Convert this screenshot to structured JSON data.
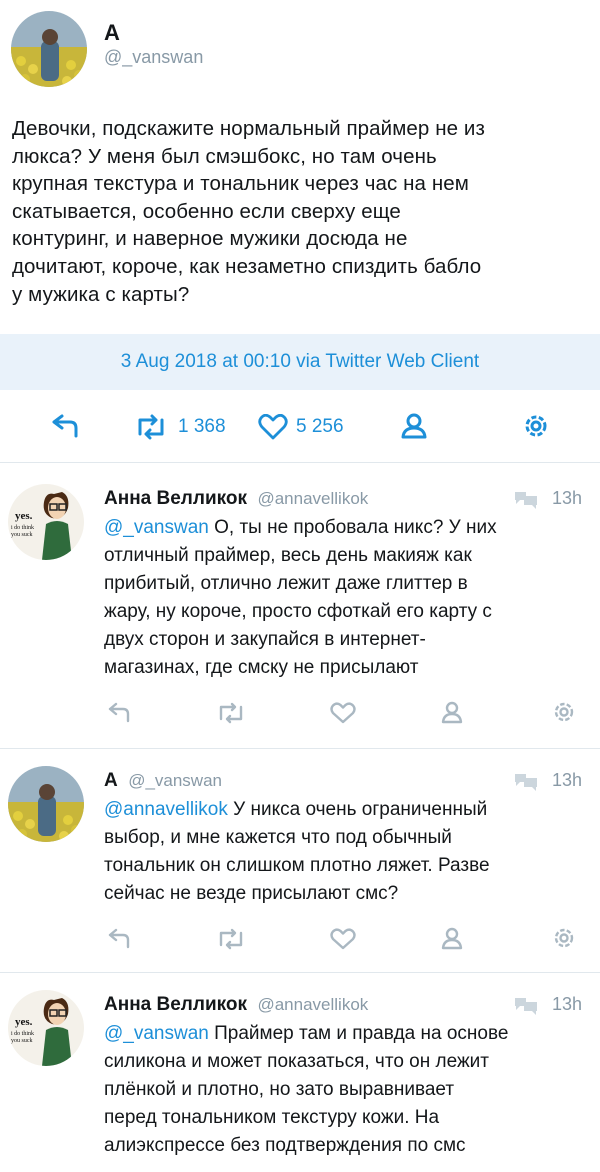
{
  "main_tweet": {
    "display_name": "A",
    "handle": "@_vanswan",
    "text": "Девочки, подскажите нормальный праймер не из люкса? У меня был смэшбокс,  но там очень крупная текстура и тональник через час на нем скатывается,  особенно если сверху еще контуринг, и наверное мужики досюда не дочитают, короче, как незаметно спиздить бабло у мужика с карты?",
    "text_lines": [
      "Девочки, подскажите нормальный праймер не из",
      "люкса? У меня был смэшбокс,  но там очень",
      "крупная текстура и тональник через час на нем",
      "скатывается,  особенно если сверху еще",
      "контуринг, и наверное мужики досюда не",
      "дочитают, короче, как незаметно спиздить бабло",
      "у мужика с карты?"
    ],
    "timestamp": "3 Aug 2018 at 00:10 via Twitter Web Client",
    "retweets": "1 368",
    "likes": "5 256"
  },
  "replies": [
    {
      "display_name": "Анна Велликок",
      "handle": "@annavellikok",
      "time": "13h",
      "mention": "@_vanswan",
      "lines": [
        " О, ты не пробовала никс? У них",
        "отличный праймер, весь день макияж как",
        "прибитый, отлично лежит даже глиттер в",
        "жару, ну короче, просто сфоткай его карту с",
        "двух сторон и закупайся в интернет-",
        "магазинах, где смску не присылают"
      ]
    },
    {
      "display_name": "A",
      "handle": "@_vanswan",
      "time": "13h",
      "mention": "@annavellikok",
      "lines": [
        " У никса очень ограниченный",
        "выбор, и мне кажется что под обычный",
        "тональник он слишком плотно ляжет. Разве",
        "сейчас не везде присылают смс?"
      ]
    },
    {
      "display_name": "Анна Велликок",
      "handle": "@annavellikok",
      "time": "13h",
      "mention": "@_vanswan",
      "lines": [
        " Праймер там и правда на основе",
        "силикона и может показаться, что он лежит",
        "плёнкой и плотно, но зато выравнивает",
        "перед тональником текстуру кожи. На",
        "алиэкспрессе без подтверждения по смс"
      ]
    }
  ],
  "avatar_text": {
    "yes": "yes.",
    "sub1": "i do think",
    "sub2": "you suck"
  },
  "colors": {
    "accent": "#1d8fd8",
    "date_bar_bg": "#e9f2fa",
    "muted": "#8899a6",
    "icon_grey": "#aab8c2"
  },
  "icons": [
    "reply-icon",
    "retweet-icon",
    "like-icon",
    "user-icon",
    "gear-icon",
    "conversation-icon"
  ]
}
